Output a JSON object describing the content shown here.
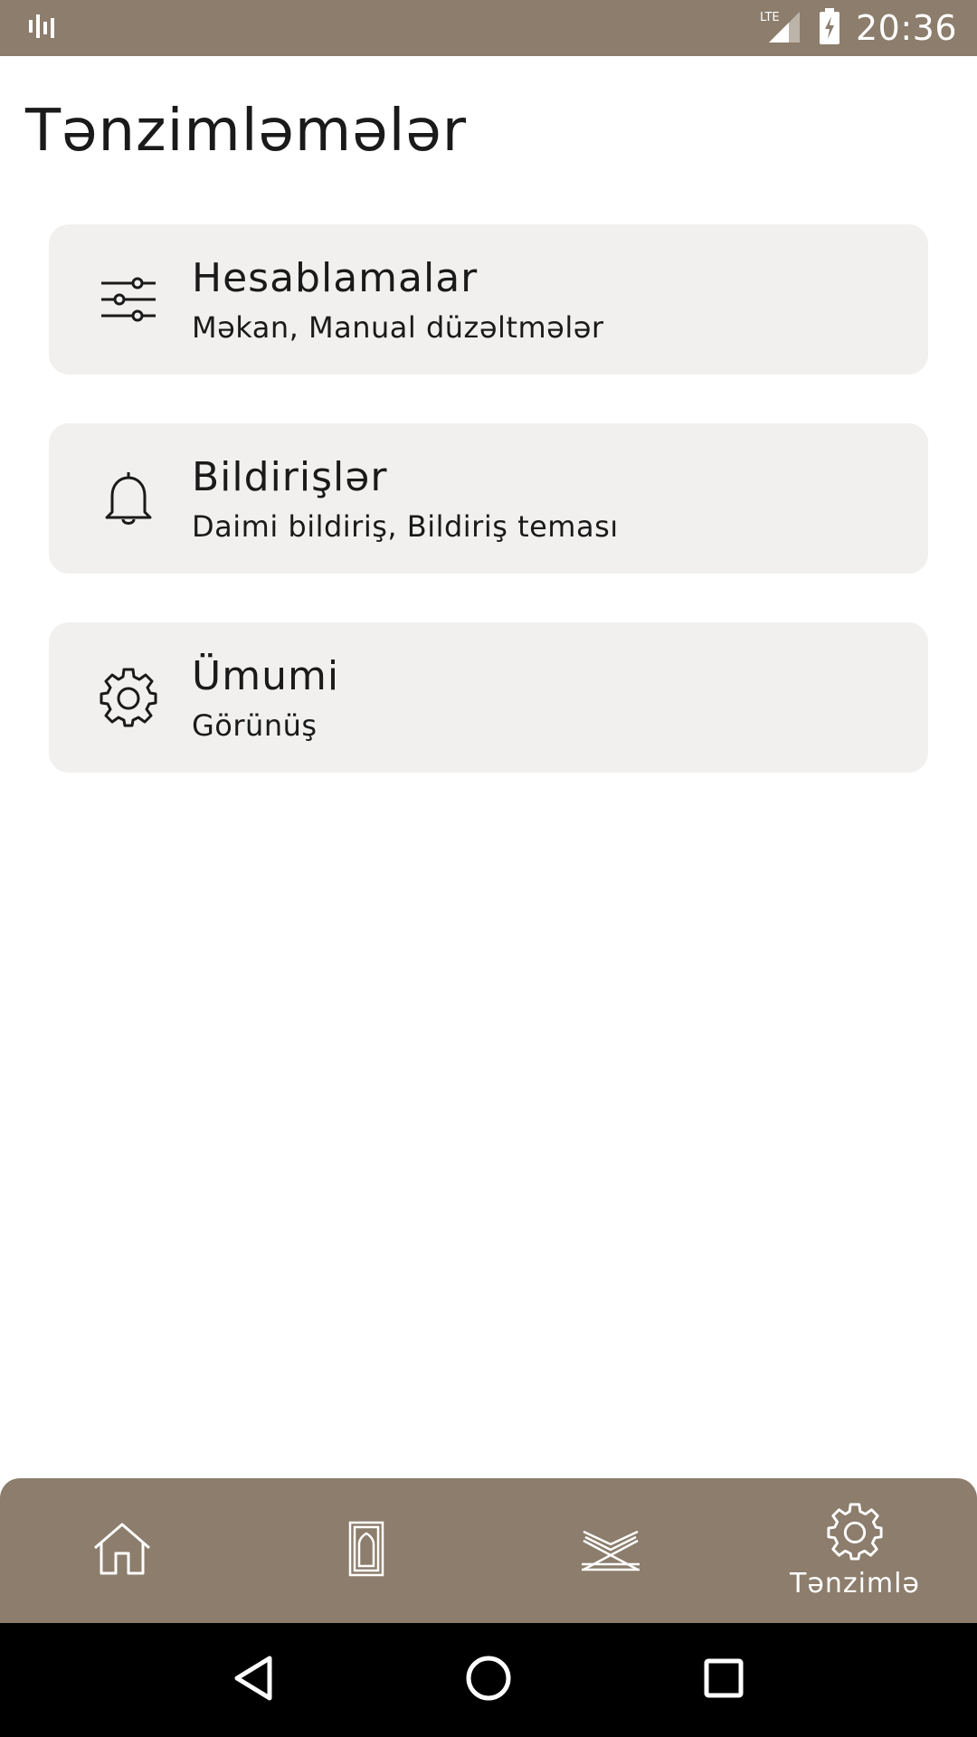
{
  "status_bar": {
    "time": "20:36",
    "network": "LTE",
    "icons": [
      "signal-bars-icon",
      "lte-signal-icon",
      "battery-charging-icon"
    ]
  },
  "page": {
    "title": "Tənzimləmələr"
  },
  "settings": [
    {
      "title": "Hesablamalar",
      "subtitle": "Məkan, Manual düzəltmələr",
      "icon": "sliders-icon"
    },
    {
      "title": "Bildirişlər",
      "subtitle": "Daimi bildiriş, Bildiriş teması",
      "icon": "bell-icon"
    },
    {
      "title": "Ümumi",
      "subtitle": "Görünüş",
      "icon": "gear-icon"
    }
  ],
  "bottom_nav": {
    "items": [
      {
        "icon": "home-icon",
        "label": ""
      },
      {
        "icon": "prayer-rug-icon",
        "label": ""
      },
      {
        "icon": "quran-stand-icon",
        "label": ""
      },
      {
        "icon": "gear-icon",
        "label": "Tənzimlə",
        "active": true
      }
    ]
  },
  "system_nav": {
    "icons": [
      "back-icon",
      "home-circle-icon",
      "recents-icon"
    ]
  },
  "colors": {
    "brand": "#8c7d6c",
    "card_bg": "#f1f0ef",
    "text": "#1a1a1a"
  }
}
